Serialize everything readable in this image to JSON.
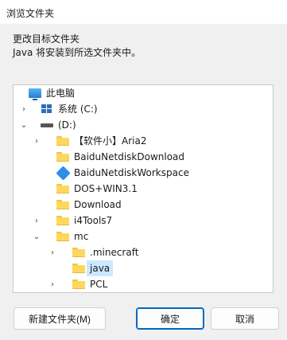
{
  "window": {
    "title": "浏览文件夹"
  },
  "instructions": {
    "line1": "更改目标文件夹",
    "line2": "Java 将安装到所选文件夹中。"
  },
  "tree": [
    {
      "label": "此电脑",
      "icon": "computer-icon",
      "chevron": "",
      "level": 0
    },
    {
      "label": "系统 (C:)",
      "icon": "windows-drive-icon",
      "chevron": "›",
      "level": 1
    },
    {
      "label": "(D:)",
      "icon": "drive-icon",
      "chevron": "⌄",
      "level": 1
    },
    {
      "label": "【软件小】Aria2",
      "icon": "folder-icon",
      "chevron": "›",
      "level": 2
    },
    {
      "label": "BaiduNetdiskDownload",
      "icon": "folder-icon",
      "chevron": "",
      "level": 2
    },
    {
      "label": "BaiduNetdiskWorkspace",
      "icon": "baidu-netdisk-icon",
      "chevron": "",
      "level": 2
    },
    {
      "label": "DOS+WIN3.1",
      "icon": "folder-icon",
      "chevron": "",
      "level": 2
    },
    {
      "label": "Download",
      "icon": "folder-icon",
      "chevron": "",
      "level": 2
    },
    {
      "label": "i4Tools7",
      "icon": "folder-icon",
      "chevron": "›",
      "level": 2
    },
    {
      "label": "mc",
      "icon": "folder-icon",
      "chevron": "⌄",
      "level": 2
    },
    {
      "label": ".minecraft",
      "icon": "folder-icon",
      "chevron": "›",
      "level": 3
    },
    {
      "label": "java",
      "icon": "folder-icon",
      "chevron": "",
      "level": 3,
      "selected": true
    },
    {
      "label": "PCL",
      "icon": "folder-icon",
      "chevron": "›",
      "level": 3
    }
  ],
  "buttons": {
    "new_folder": "新建文件夹(M)",
    "ok": "确定",
    "cancel": "取消"
  }
}
